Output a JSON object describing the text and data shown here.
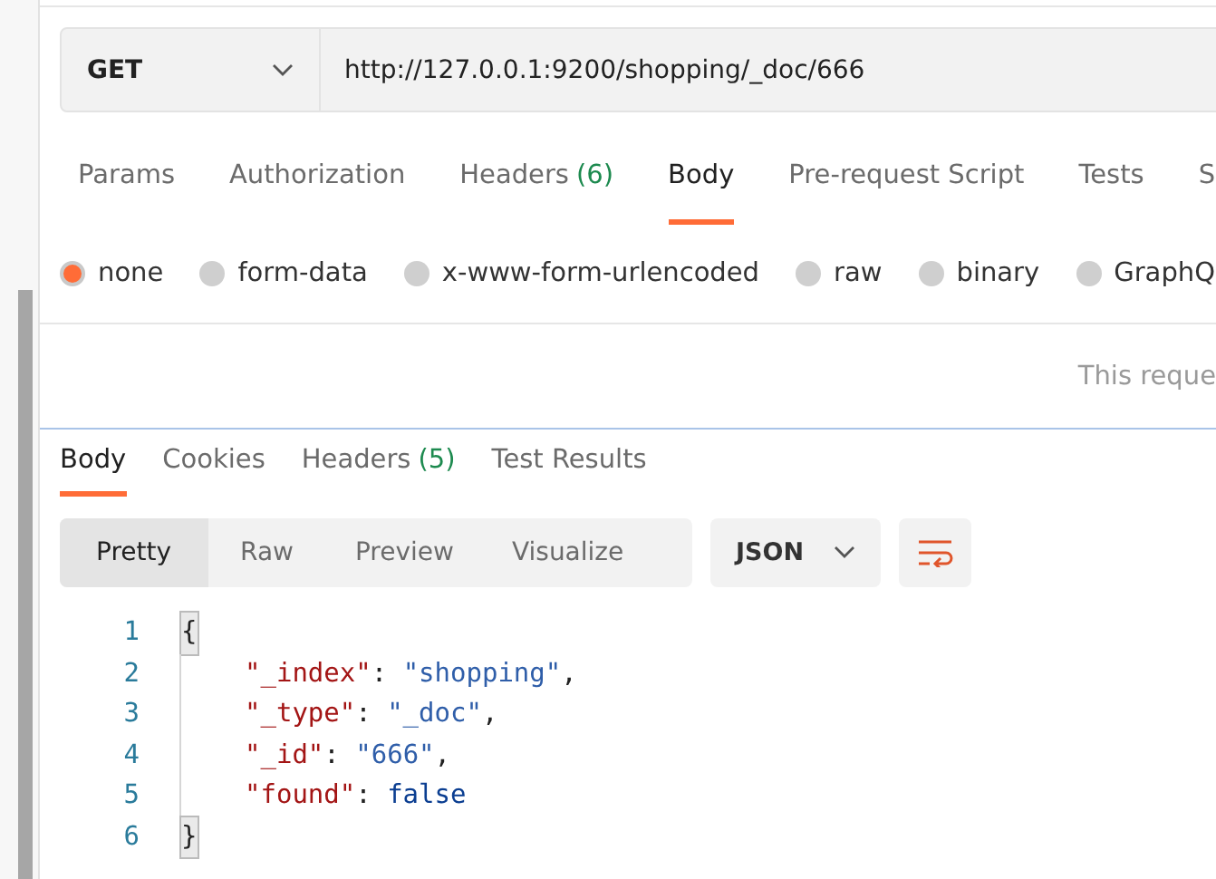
{
  "request": {
    "method": "GET",
    "url": "http://127.0.0.1:9200/shopping/_doc/666"
  },
  "request_tabs": [
    {
      "label": "Params",
      "selected": false
    },
    {
      "label": "Authorization",
      "selected": false
    },
    {
      "label": "Headers",
      "count": "(6)",
      "selected": false
    },
    {
      "label": "Body",
      "selected": true
    },
    {
      "label": "Pre-request Script",
      "selected": false
    },
    {
      "label": "Tests",
      "selected": false
    },
    {
      "label": "S",
      "selected": false
    }
  ],
  "body_types": [
    {
      "label": "none",
      "selected": true
    },
    {
      "label": "form-data",
      "selected": false
    },
    {
      "label": "x-www-form-urlencoded",
      "selected": false
    },
    {
      "label": "raw",
      "selected": false
    },
    {
      "label": "binary",
      "selected": false
    },
    {
      "label": "GraphQ",
      "selected": false
    }
  ],
  "body_message": "This reque",
  "response_tabs": [
    {
      "label": "Body",
      "selected": true
    },
    {
      "label": "Cookies",
      "selected": false
    },
    {
      "label": "Headers",
      "count": "(5)",
      "selected": false
    },
    {
      "label": "Test Results",
      "selected": false
    }
  ],
  "view_modes": [
    {
      "label": "Pretty",
      "selected": true
    },
    {
      "label": "Raw",
      "selected": false
    },
    {
      "label": "Preview",
      "selected": false
    },
    {
      "label": "Visualize",
      "selected": false
    }
  ],
  "format": "JSON",
  "code_lines": [
    {
      "number": "1",
      "indent": false,
      "tokens": [
        {
          "kind": "brace",
          "text": "{"
        }
      ]
    },
    {
      "number": "2",
      "indent": true,
      "tokens": [
        {
          "kind": "key",
          "text": "\"_index\""
        },
        {
          "kind": "punct",
          "text": ": "
        },
        {
          "kind": "string",
          "text": "\"shopping\""
        },
        {
          "kind": "punct",
          "text": ","
        }
      ]
    },
    {
      "number": "3",
      "indent": true,
      "tokens": [
        {
          "kind": "key",
          "text": "\"_type\""
        },
        {
          "kind": "punct",
          "text": ": "
        },
        {
          "kind": "string",
          "text": "\"_doc\""
        },
        {
          "kind": "punct",
          "text": ","
        }
      ]
    },
    {
      "number": "4",
      "indent": true,
      "tokens": [
        {
          "kind": "key",
          "text": "\"_id\""
        },
        {
          "kind": "punct",
          "text": ": "
        },
        {
          "kind": "string",
          "text": "\"666\""
        },
        {
          "kind": "punct",
          "text": ","
        }
      ]
    },
    {
      "number": "5",
      "indent": true,
      "tokens": [
        {
          "kind": "key",
          "text": "\"found\""
        },
        {
          "kind": "punct",
          "text": ": "
        },
        {
          "kind": "keyword",
          "text": "false"
        }
      ]
    },
    {
      "number": "6",
      "indent": false,
      "tokens": [
        {
          "kind": "brace",
          "text": "}"
        }
      ]
    }
  ]
}
